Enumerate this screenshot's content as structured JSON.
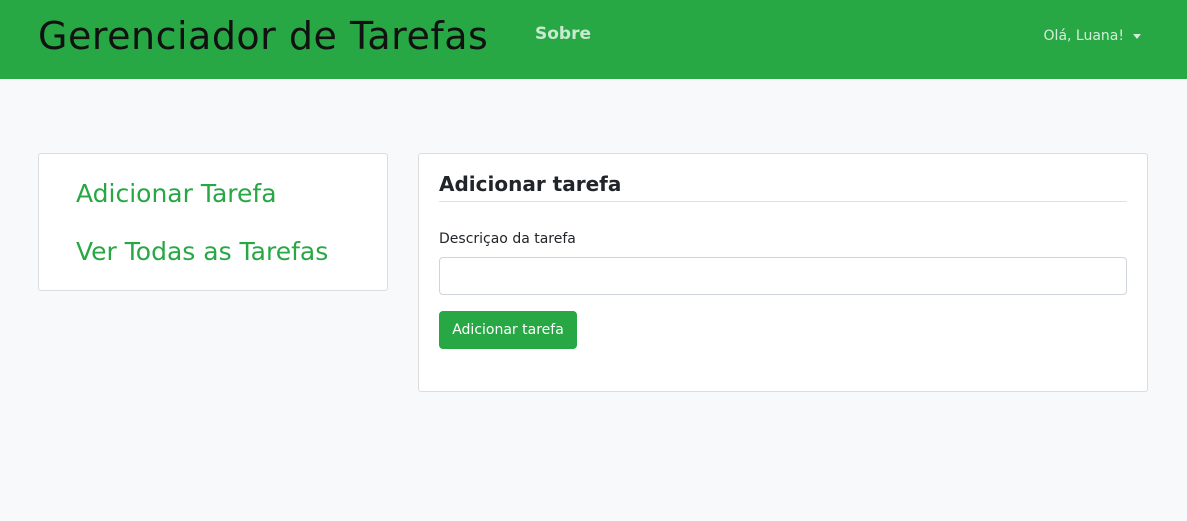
{
  "navbar": {
    "brand": "Gerenciador de Tarefas",
    "about_link": "Sobre",
    "user_greeting": "Olá, Luana!",
    "bg_color": "#28a745"
  },
  "sidebar": {
    "items": [
      {
        "label": "Adicionar Tarefa"
      },
      {
        "label": "Ver Todas as Tarefas"
      }
    ]
  },
  "form": {
    "title": "Adicionar tarefa",
    "description_label": "Descriçao da tarefa",
    "description_value": "",
    "submit_label": "Adicionar tarefa"
  }
}
